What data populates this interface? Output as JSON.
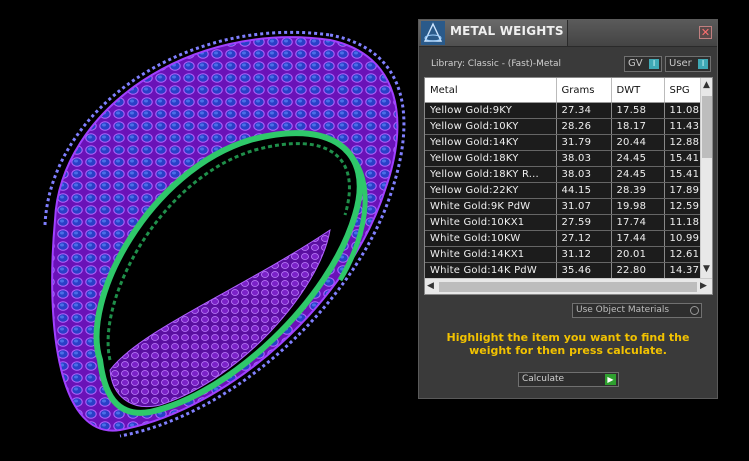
{
  "window": {
    "title": "METAL WEIGHTS",
    "close_glyph": "✕",
    "library_label": "Library: Classic - (Fast)-Metal",
    "gv_label": "GV",
    "user_label": "User",
    "toggle_indicator": "I"
  },
  "table": {
    "columns": [
      "Metal",
      "Grams",
      "DWT",
      "SPG"
    ],
    "rows": [
      [
        "Yellow Gold:9KY",
        "27.34",
        "17.58",
        "11.08"
      ],
      [
        "Yellow Gold:10KY",
        "28.26",
        "18.17",
        "11.43"
      ],
      [
        "Yellow Gold:14KY",
        "31.79",
        "20.44",
        "12.88"
      ],
      [
        "Yellow Gold:18KY",
        "38.03",
        "24.45",
        "15.41"
      ],
      [
        "Yellow Gold:18KY R...",
        "38.03",
        "24.45",
        "15.41"
      ],
      [
        "Yellow Gold:22KY",
        "44.15",
        "28.39",
        "17.89"
      ],
      [
        "White Gold:9K PdW",
        "31.07",
        "19.98",
        "12.59"
      ],
      [
        "White Gold:10KX1",
        "27.59",
        "17.74",
        "11.18"
      ],
      [
        "White Gold:10KW",
        "27.12",
        "17.44",
        "10.99"
      ],
      [
        "White Gold:14KX1",
        "31.12",
        "20.01",
        "12.61"
      ],
      [
        "White Gold:14K PdW",
        "35.46",
        "22.80",
        "14.37"
      ]
    ]
  },
  "options": {
    "use_object_materials": "Use Object Materials"
  },
  "instruction": "Highlight the item you want to find the weight for then press calculate.",
  "calculate_label": "Calculate",
  "colors": {
    "ring_purple": "#8a1fd0",
    "gem_blue": "#1f4fc0",
    "inner_green": "#2fc86a",
    "instruction_yellow": "#f2c200"
  },
  "icons": {
    "app": "wireframe-ring-icon",
    "close": "close-icon",
    "scroll_up": "chevron-up-icon",
    "scroll_down": "chevron-down-icon",
    "scroll_left": "chevron-left-icon",
    "scroll_right": "chevron-right-icon",
    "calculate": "play-arrow-icon"
  }
}
